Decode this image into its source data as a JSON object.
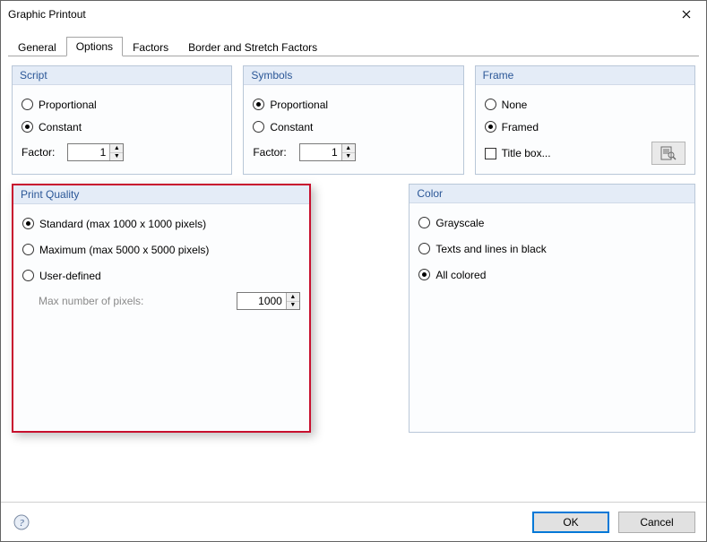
{
  "window": {
    "title": "Graphic Printout"
  },
  "tabs": {
    "general": "General",
    "options": "Options",
    "factors": "Factors",
    "border": "Border and Stretch Factors"
  },
  "script": {
    "title": "Script",
    "proportional": "Proportional",
    "constant": "Constant",
    "factor_label": "Factor:",
    "factor_value": "1"
  },
  "symbols": {
    "title": "Symbols",
    "proportional": "Proportional",
    "constant": "Constant",
    "factor_label": "Factor:",
    "factor_value": "1"
  },
  "frame": {
    "title": "Frame",
    "none": "None",
    "framed": "Framed",
    "title_box": "Title box..."
  },
  "print_quality": {
    "title": "Print Quality",
    "standard": "Standard (max 1000 x 1000 pixels)",
    "maximum": "Maximum (max 5000 x 5000 pixels)",
    "user_defined": "User-defined",
    "max_pixels_label": "Max number of pixels:",
    "max_pixels_value": "1000"
  },
  "color": {
    "title": "Color",
    "grayscale": "Grayscale",
    "texts_black": "Texts and lines in black",
    "all_colored": "All colored"
  },
  "buttons": {
    "ok": "OK",
    "cancel": "Cancel"
  }
}
